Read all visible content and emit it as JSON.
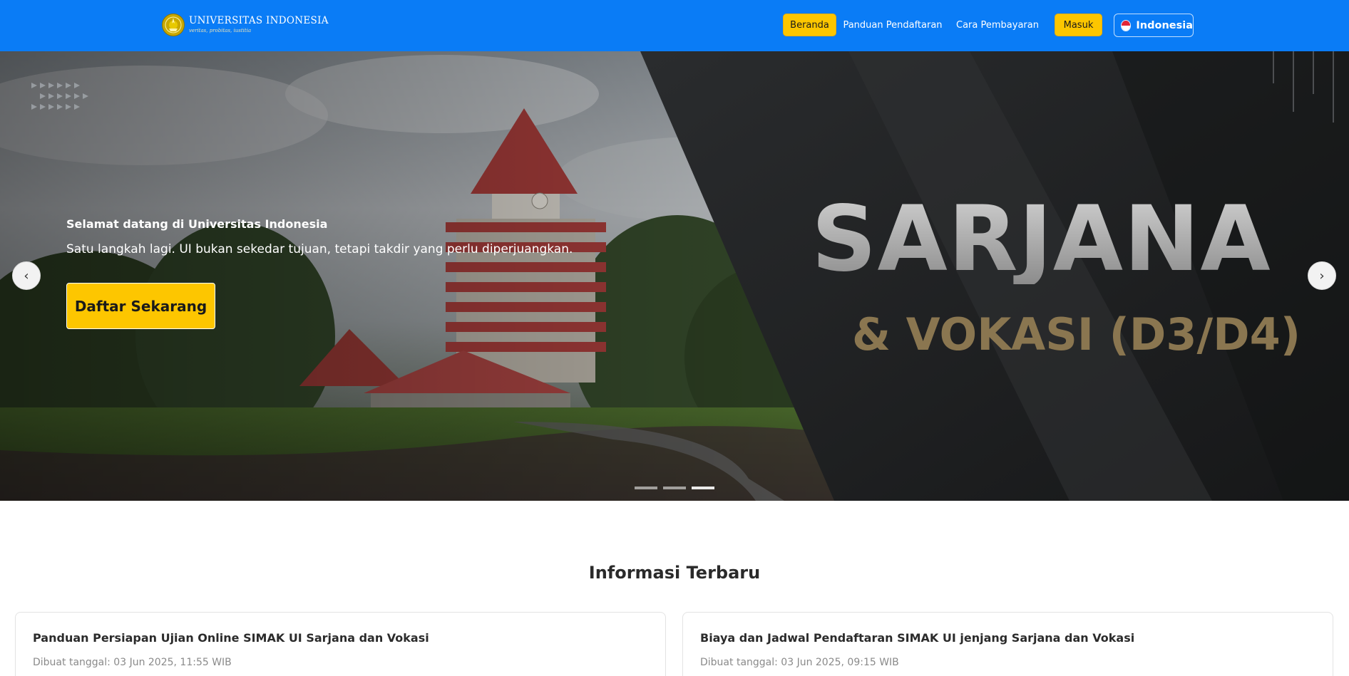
{
  "navbar": {
    "brand_name": "UNIVERSITAS INDONESIA",
    "brand_tagline": "veritas, probitas, iustitia",
    "items": [
      {
        "label": "Beranda",
        "style": "highlight"
      },
      {
        "label": "Panduan Pendaftaran",
        "style": "link"
      },
      {
        "label": "Cara Pembayaran",
        "style": "link"
      },
      {
        "label": "Masuk",
        "style": "highlight"
      }
    ],
    "language": "Indonesia"
  },
  "hero": {
    "welcome": "Selamat datang di Universitas Indonesia",
    "tagline": "Satu langkah lagi. UI bukan sekedar tujuan, tetapi takdir yang perlu diperjuangkan.",
    "cta_label": "Daftar Sekarang",
    "banner_title": "SARJANA",
    "banner_subtitle": "& VOKASI (D3/D4)",
    "prev_icon": "chevron-left-icon",
    "next_icon": "chevron-right-icon",
    "slide_count": 3,
    "active_slide": 3
  },
  "info": {
    "section_title": "Informasi Terbaru",
    "cards": [
      {
        "title": "Panduan Persiapan Ujian Online SIMAK UI Sarjana dan Vokasi",
        "date": "Dibuat tanggal: 03 Jun 2025, 11:55 WIB"
      },
      {
        "title": "Biaya dan Jadwal Pendaftaran SIMAK UI jenjang Sarjana dan Vokasi",
        "date": "Dibuat tanggal: 03 Jun 2025, 09:15 WIB"
      }
    ]
  },
  "colors": {
    "navbar": "#0a7cf6",
    "accent_yellow": "#fdc600",
    "banner_dark": "#1c1e20",
    "banner_gold": "#8a7650"
  }
}
